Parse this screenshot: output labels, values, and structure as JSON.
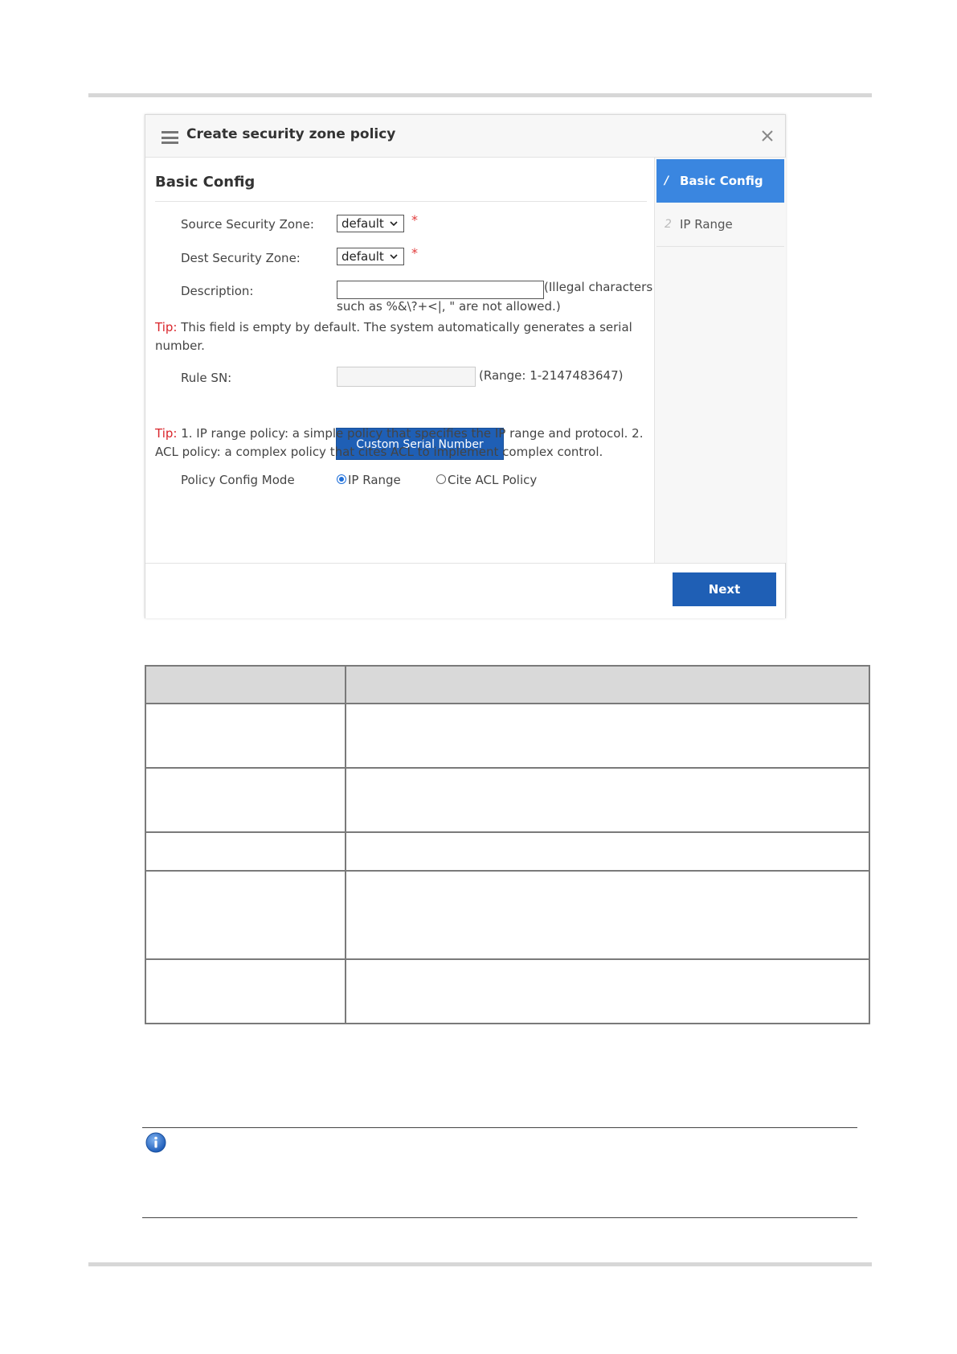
{
  "dialog": {
    "title": "Create security zone policy",
    "section_title": "Basic Config",
    "fields": {
      "source_zone_label": "Source Security Zone:",
      "source_zone_value": "default",
      "dest_zone_label": "Dest Security Zone:",
      "dest_zone_value": "default",
      "required_mark": "*",
      "description_label": "Description:",
      "description_value": "",
      "description_hint_1": "(Illegal characters",
      "description_hint_2": "such as %&\\?+<|, \" are not allowed.)",
      "rule_sn_label": "Rule SN:",
      "rule_sn_value": "",
      "rule_sn_hint": "(Range: 1-2147483647)",
      "custom_serial_button": "Custom Serial Number",
      "policy_mode_label": "Policy Config Mode",
      "policy_mode_options": [
        "IP Range",
        "Cite ACL Policy"
      ],
      "policy_mode_selected": "IP Range"
    },
    "tips": {
      "tip_key": "Tip:",
      "tip1_text": " This field is empty by default. The system automatically generates a serial number.",
      "tip2_text": " 1. IP range policy: a simple policy that specifies the IP range and protocol. 2. ACL policy: a complex policy that cites ACL to implement complex control."
    },
    "steps": [
      {
        "num": "1",
        "label": "Basic Config",
        "active": true
      },
      {
        "num": "2",
        "label": "IP Range",
        "active": false
      }
    ],
    "next_button": "Next"
  },
  "colors": {
    "primary_button": "#1f5fb5",
    "active_step": "#3a86e0",
    "tip_red": "#d9252b",
    "table_header": "#d9d9d9"
  },
  "icons": [
    "menu-icon",
    "close-icon",
    "chevron-down-icon",
    "pencil-icon",
    "info-icon"
  ]
}
